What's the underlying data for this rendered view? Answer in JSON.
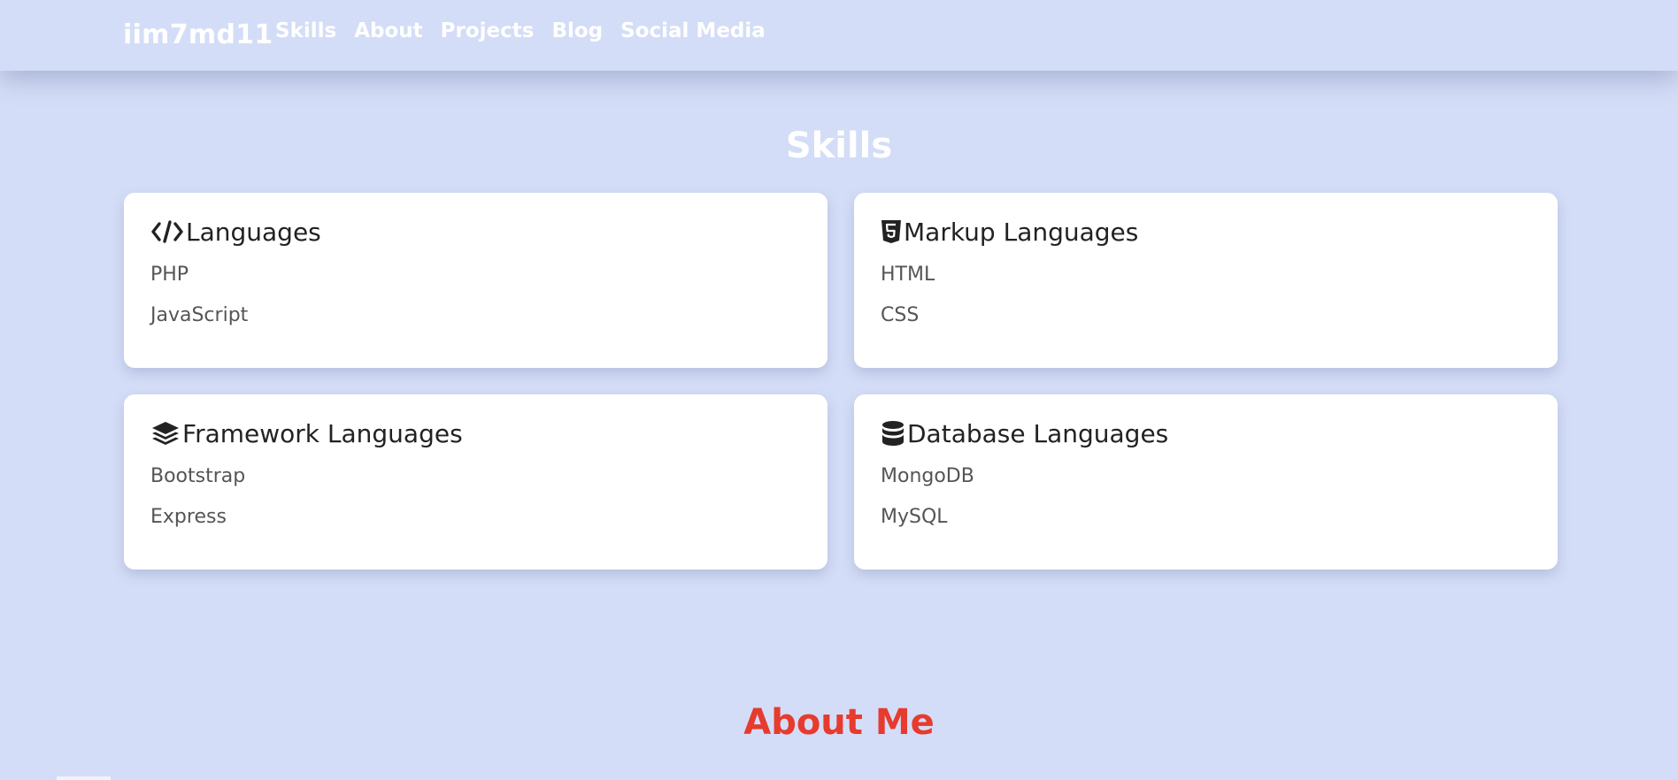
{
  "nav": {
    "brand": "iim7md11",
    "links": [
      "Skills",
      "About",
      "Projects",
      "Blog",
      "Social Media"
    ]
  },
  "skills": {
    "title": "Skills",
    "cards": [
      {
        "title": "Languages",
        "icon": "code-icon",
        "items": [
          "PHP",
          "JavaScript"
        ]
      },
      {
        "title": "Markup Languages",
        "icon": "html5-icon",
        "items": [
          "HTML",
          "CSS"
        ]
      },
      {
        "title": "Framework Languages",
        "icon": "layer-group-icon",
        "items": [
          "Bootstrap",
          "Express"
        ]
      },
      {
        "title": "Database Languages",
        "icon": "database-icon",
        "items": [
          "MongoDB",
          "MySQL"
        ]
      }
    ]
  },
  "about": {
    "title": "About Me"
  },
  "colors": {
    "page_bg": "#d4ddf7",
    "card_bg": "#ffffff",
    "about_title": "#e63b2e",
    "text_dark": "#222222",
    "text_muted": "#555555"
  }
}
